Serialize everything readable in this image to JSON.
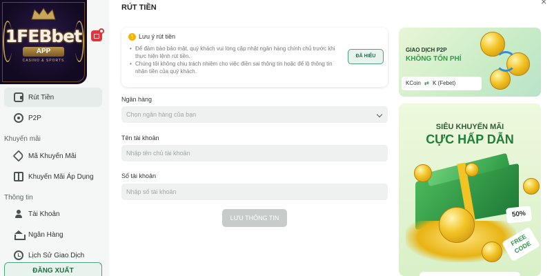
{
  "sidebar": {
    "logo": {
      "brand": "1FEBbet",
      "app": "APP",
      "tagline": "CASINO & SPORTS"
    },
    "items": [
      {
        "label": "Rút Tiền",
        "icon": "wallet-icon",
        "active": true
      },
      {
        "label": "P2P",
        "icon": "p2p-icon",
        "active": false
      }
    ],
    "sections": [
      {
        "title": "Khuyến mãi",
        "items": [
          {
            "label": "Mã Khuyến Mãi",
            "icon": "tag-icon"
          },
          {
            "label": "Khuyến Mãi Áp Dụng",
            "icon": "gift-icon"
          }
        ]
      },
      {
        "title": "Thông tin",
        "items": [
          {
            "label": "Tài Khoản",
            "icon": "user-icon"
          },
          {
            "label": "Ngân Hàng",
            "icon": "bank-icon"
          },
          {
            "label": "Lịch Sử Giao Dịch",
            "icon": "history-icon"
          }
        ]
      }
    ],
    "logout_label": "ĐĂNG XUẤT"
  },
  "main": {
    "title": "RÚT TIỀN",
    "notice": {
      "title": "Lưu ý rút tiền",
      "lines": [
        "Để đảm bảo bảo mật, quý khách vui lòng cập nhật ngân hàng chính chủ trước khi thực hiện lệnh rút tiền.",
        "Chúng tôi không chịu trách nhiệm cho việc điền sai thông tin hoặc để lộ thông tin nhận tiền của quý khách."
      ],
      "ack_label": "ĐÃ HIỂU"
    },
    "form": {
      "bank_label": "Ngân hàng",
      "bank_placeholder": "Chọn ngân hàng của bạn",
      "account_name_label": "Tên tài khoản",
      "account_name_placeholder": "Nhập tên chủ tài khoản",
      "account_number_label": "Số tài khoản",
      "account_number_placeholder": "Nhập số tài khoản",
      "save_label": "LƯU THÔNG TIN"
    }
  },
  "banners": {
    "p2p": {
      "title": "GIAO DỊCH P2P",
      "subtitle": "KHÔNG TỐN PHÍ",
      "from": "KCoin",
      "to": "K (Febet)"
    },
    "promo": {
      "title": "SIÊU KHUYẾN MÃI",
      "headline": "CỰC HẤP DẪN",
      "percent": "50%",
      "code_line1": "FREE",
      "code_line2": "CODE"
    }
  },
  "colors": {
    "accent": "#2f9a4c",
    "accent_dark": "#236a48",
    "badge": "#e0353d",
    "warning": "#f5b400"
  }
}
